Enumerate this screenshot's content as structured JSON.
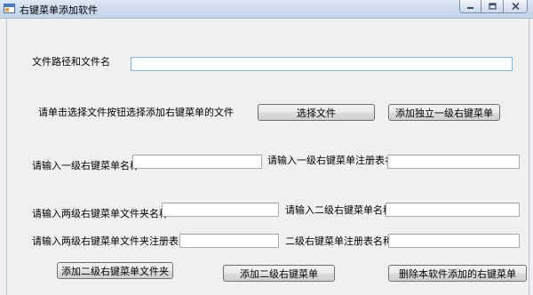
{
  "window": {
    "title": "右键菜单添加软件",
    "icon": "app-window-icon"
  },
  "form": {
    "path_label": "文件路径和文件名",
    "path_value": "",
    "hint_text": "请单击选择文件按钮选择添加右键菜单的文件",
    "select_file_button": "选择文件",
    "add_standalone_button": "添加独立一级右键菜单",
    "level1_name_label": "请输入一级右键菜单名称",
    "level1_name_value": "",
    "level1_reg_label": "请输入一级右键菜单注册表名",
    "level1_reg_value": "",
    "level2_folder_name_label": "请输入两级右键菜单文件夹名称",
    "level2_folder_name_value": "",
    "level2_name_label": "请输入二级右键菜单名称",
    "level2_name_value": "",
    "level2_folder_reg_label": "请输入两级右键菜单文件夹注册表名",
    "level2_folder_reg_value": "",
    "level2_reg_label": "二级右键菜单注册表名称",
    "level2_reg_value": "",
    "add_level2_folder_button": "添加二级右键菜单文件夹",
    "add_level2_button": "添加二级右键菜单",
    "delete_added_button": "删除本软件添加的右键菜单"
  }
}
